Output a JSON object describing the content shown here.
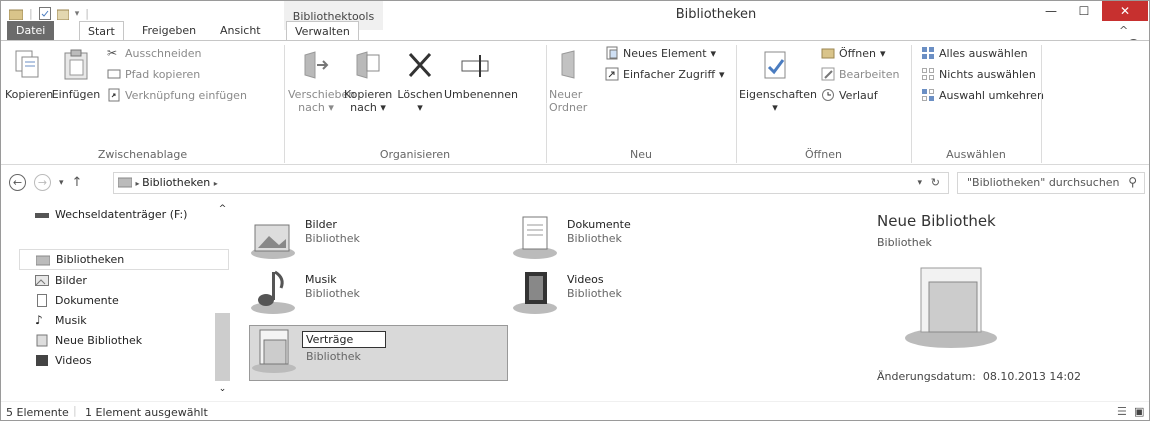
{
  "window": {
    "title": "Bibliotheken",
    "context_tab_header": "Bibliothektools"
  },
  "ribbon_tabs": [
    "Datei",
    "Start",
    "Freigeben",
    "Ansicht",
    "Verwalten"
  ],
  "ribbon": {
    "clipboard": {
      "copy": "Kopieren",
      "paste": "Einfügen",
      "cut": "Ausschneiden",
      "copy_path": "Pfad kopieren",
      "paste_shortcut": "Verknüpfung einfügen",
      "label": "Zwischenablage"
    },
    "organize": {
      "move_to_1": "Verschieben",
      "move_to_2": "nach",
      "copy_to_1": "Kopieren",
      "copy_to_2": "nach",
      "delete": "Löschen",
      "rename": "Umbenennen",
      "label": "Organisieren"
    },
    "new": {
      "new_folder_1": "Neuer",
      "new_folder_2": "Ordner",
      "new_item": "Neues Element",
      "easy_access": "Einfacher Zugriff",
      "label": "Neu"
    },
    "open": {
      "properties": "Eigenschaften",
      "open": "Öffnen",
      "edit": "Bearbeiten",
      "history": "Verlauf",
      "label": "Öffnen"
    },
    "select": {
      "select_all": "Alles auswählen",
      "select_none": "Nichts auswählen",
      "invert": "Auswahl umkehren",
      "label": "Auswählen"
    }
  },
  "address": {
    "path": "Bibliotheken",
    "search_placeholder": "\"Bibliotheken\" durchsuchen"
  },
  "nav": {
    "removable": "Wechseldatenträger (F:)",
    "libraries": "Bibliotheken",
    "items": [
      "Bilder",
      "Dokumente",
      "Musik",
      "Neue Bibliothek",
      "Videos"
    ]
  },
  "content": {
    "libraries": [
      {
        "name": "Bilder",
        "type": "Bibliothek"
      },
      {
        "name": "Dokumente",
        "type": "Bibliothek"
      },
      {
        "name": "Musik",
        "type": "Bibliothek"
      },
      {
        "name": "Videos",
        "type": "Bibliothek"
      },
      {
        "name": "Verträge",
        "type": "Bibliothek"
      }
    ]
  },
  "details": {
    "title": "Neue Bibliothek",
    "type": "Bibliothek",
    "modified_label": "Änderungsdatum:",
    "modified_value": "08.10.2013 14:02"
  },
  "status": {
    "count": "5 Elemente",
    "selected": "1 Element ausgewählt"
  },
  "icons": {
    "close": "close-icon",
    "minimize": "minimize-icon",
    "maximize": "maximize-icon",
    "help": "help-icon",
    "search": "search-icon",
    "refresh": "refresh-icon"
  },
  "colors": {
    "close_button": "#c7302f",
    "datei_tab": "#6b6b6b",
    "selection": "#d9d9d9"
  }
}
